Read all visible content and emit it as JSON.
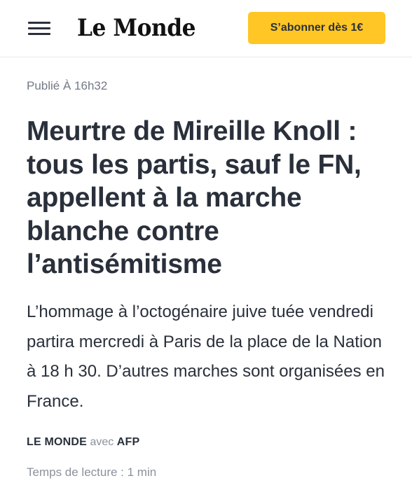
{
  "header": {
    "logo_text": "Le Monde",
    "subscribe_label": "S’abonner dès 1€"
  },
  "article": {
    "published": "Publié À 16h32",
    "title": "Meurtre de Mireille Knoll : tous les partis, sauf le FN, appellent à la marche blanche contre l’antisémitisme",
    "lede": "L’hommage à l’octogénaire juive tuée vendredi partira mercredi à Paris de la place de la Nation à 18 h 30. D’autres marches sont organisées en France.",
    "byline": {
      "author": "LE MONDE",
      "with_word": "avec",
      "agency": "AFP"
    },
    "reading_time": "Temps de lecture : 1 min"
  },
  "colors": {
    "accent": "#ffc625",
    "text": "#2a303b",
    "muted": "#737a86"
  },
  "icons": {
    "menu": "hamburger-menu-icon"
  }
}
